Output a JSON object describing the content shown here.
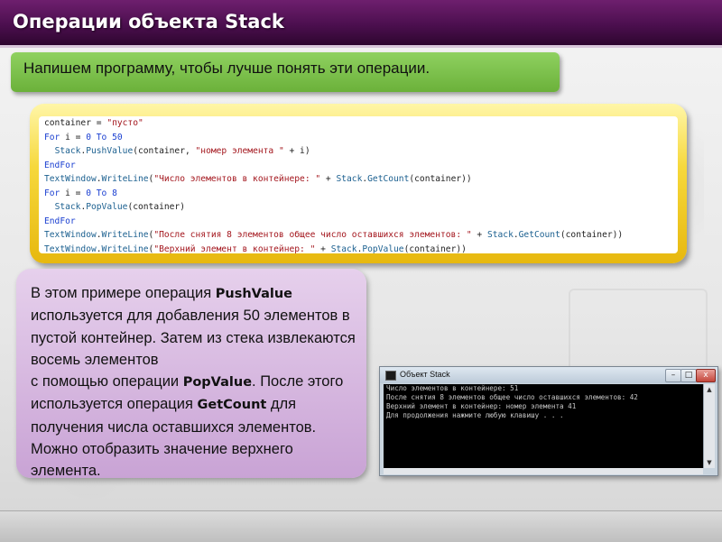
{
  "slide": {
    "title": "Операции объекта Stack",
    "intro": "Напишем программу, чтобы лучше понять эти операции."
  },
  "code": {
    "lines": [
      [
        {
          "t": "plain",
          "v": "container = "
        },
        {
          "t": "str",
          "v": "\"пусто\""
        }
      ],
      [
        {
          "t": "kw",
          "v": "For"
        },
        {
          "t": "plain",
          "v": " i = "
        },
        {
          "t": "kw",
          "v": "0"
        },
        {
          "t": "plain",
          "v": " "
        },
        {
          "t": "kw",
          "v": "To"
        },
        {
          "t": "plain",
          "v": " "
        },
        {
          "t": "kw",
          "v": "50"
        }
      ],
      [
        {
          "t": "plain",
          "v": "  "
        },
        {
          "t": "id",
          "v": "Stack"
        },
        {
          "t": "plain",
          "v": "."
        },
        {
          "t": "id",
          "v": "PushValue"
        },
        {
          "t": "plain",
          "v": "(container, "
        },
        {
          "t": "str",
          "v": "\"номер элемента \""
        },
        {
          "t": "plain",
          "v": " + i)"
        }
      ],
      [
        {
          "t": "kw",
          "v": "EndFor"
        }
      ],
      [
        {
          "t": "id",
          "v": "TextWindow"
        },
        {
          "t": "plain",
          "v": "."
        },
        {
          "t": "id",
          "v": "WriteLine"
        },
        {
          "t": "plain",
          "v": "("
        },
        {
          "t": "str",
          "v": "\"Число элементов в контейнере: \""
        },
        {
          "t": "plain",
          "v": " + "
        },
        {
          "t": "id",
          "v": "Stack"
        },
        {
          "t": "plain",
          "v": "."
        },
        {
          "t": "id",
          "v": "GetCount"
        },
        {
          "t": "plain",
          "v": "(container))"
        }
      ],
      [
        {
          "t": "kw",
          "v": "For"
        },
        {
          "t": "plain",
          "v": " i = "
        },
        {
          "t": "kw",
          "v": "0"
        },
        {
          "t": "plain",
          "v": " "
        },
        {
          "t": "kw",
          "v": "To"
        },
        {
          "t": "plain",
          "v": " "
        },
        {
          "t": "kw",
          "v": "8"
        }
      ],
      [
        {
          "t": "plain",
          "v": "  "
        },
        {
          "t": "id",
          "v": "Stack"
        },
        {
          "t": "plain",
          "v": "."
        },
        {
          "t": "id",
          "v": "PopValue"
        },
        {
          "t": "plain",
          "v": "(container)"
        }
      ],
      [
        {
          "t": "kw",
          "v": "EndFor"
        }
      ],
      [
        {
          "t": "id",
          "v": "TextWindow"
        },
        {
          "t": "plain",
          "v": "."
        },
        {
          "t": "id",
          "v": "WriteLine"
        },
        {
          "t": "plain",
          "v": "("
        },
        {
          "t": "str",
          "v": "\"После снятия 8 элементов общее число оставшихся элементов: \""
        },
        {
          "t": "plain",
          "v": " + "
        },
        {
          "t": "id",
          "v": "Stack"
        },
        {
          "t": "plain",
          "v": "."
        },
        {
          "t": "id",
          "v": "GetCount"
        },
        {
          "t": "plain",
          "v": "(container))"
        }
      ],
      [
        {
          "t": "id",
          "v": "TextWindow"
        },
        {
          "t": "plain",
          "v": "."
        },
        {
          "t": "id",
          "v": "WriteLine"
        },
        {
          "t": "plain",
          "v": "("
        },
        {
          "t": "str",
          "v": "\"Верхний элемент в контейнер: \""
        },
        {
          "t": "plain",
          "v": " + "
        },
        {
          "t": "id",
          "v": "Stack"
        },
        {
          "t": "plain",
          "v": "."
        },
        {
          "t": "id",
          "v": "PopValue"
        },
        {
          "t": "plain",
          "v": "(container))"
        }
      ]
    ]
  },
  "description": {
    "p1": "В этом примере операция ",
    "term1": "PushValue",
    "p2": " используется для добавления 50 элементов в пустой контейнер. Затем из стека извлекаются восемь элементов",
    "p3": "с помощью операции ",
    "term2": "PopValue",
    "p4": ". После этого используется операция ",
    "term3": "GetCount",
    "p5": " для получения числа оставшихся элементов. Можно отобразить значение верхнего элемента."
  },
  "console": {
    "title": "Объект Stack",
    "lines": [
      "Число элементов в контейнере: 51",
      "После снятия 8 элементов общее число оставшихся элементов: 42",
      "Верхний элемент в контейнер: номер элемента 41",
      "Для продолжения нажмите любую клавишу . . ."
    ],
    "buttons": {
      "minimize": "–",
      "maximize": "□",
      "close": "x"
    },
    "scroll_up": "▲",
    "scroll_down": "▼"
  },
  "colors": {
    "title_bar": "#4c0f4f",
    "intro_box": "#7cc04a",
    "code_frame": "#f2cf2e",
    "desc_box": "#d4b3de",
    "keyword": "#1a3fd1",
    "string": "#a3151c",
    "identifier": "#1a5f8f"
  }
}
